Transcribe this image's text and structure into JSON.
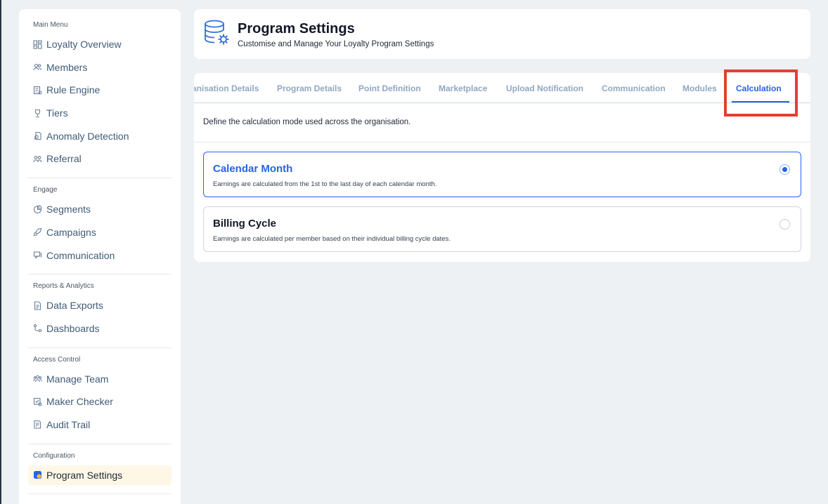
{
  "sidebar": {
    "sections": [
      {
        "title": "Main Menu",
        "items": [
          {
            "label": "Loyalty Overview",
            "icon": "grid-icon"
          },
          {
            "label": "Members",
            "icon": "users-icon"
          },
          {
            "label": "Rule Engine",
            "icon": "rule-icon"
          },
          {
            "label": "Tiers",
            "icon": "trophy-icon"
          },
          {
            "label": "Anomaly Detection",
            "icon": "anomaly-icon"
          },
          {
            "label": "Referral",
            "icon": "referral-icon"
          }
        ]
      },
      {
        "title": "Engage",
        "items": [
          {
            "label": "Segments",
            "icon": "pie-icon"
          },
          {
            "label": "Campaigns",
            "icon": "rocket-icon"
          },
          {
            "label": "Communication",
            "icon": "chat-icon"
          }
        ]
      },
      {
        "title": "Reports & Analytics",
        "items": [
          {
            "label": "Data Exports",
            "icon": "document-icon"
          },
          {
            "label": "Dashboards",
            "icon": "flow-icon"
          }
        ]
      },
      {
        "title": "Access Control",
        "items": [
          {
            "label": "Manage Team",
            "icon": "team-icon"
          },
          {
            "label": "Maker Checker",
            "icon": "checker-icon"
          },
          {
            "label": "Audit Trail",
            "icon": "audit-icon"
          }
        ]
      },
      {
        "title": "Configuration",
        "items": [
          {
            "label": "Program Settings",
            "icon": "settings-icon",
            "active": true
          }
        ]
      }
    ]
  },
  "header": {
    "title": "Program Settings",
    "subtitle": "Customise and Manage Your Loyalty Program Settings",
    "icon": "database-gear-icon"
  },
  "tabs": [
    {
      "label": "anisation Details"
    },
    {
      "label": "Program Details"
    },
    {
      "label": "Point Definition"
    },
    {
      "label": "Marketplace"
    },
    {
      "label": "Upload Notification"
    },
    {
      "label": "Communication"
    },
    {
      "label": "Modules"
    },
    {
      "label": "Calculation",
      "active": true
    }
  ],
  "calculation": {
    "description": "Define the calculation mode used across the organisation.",
    "options": [
      {
        "title": "Calendar Month",
        "description": "Earnings are calculated from the 1st to the last day of each calendar month.",
        "selected": true
      },
      {
        "title": "Billing Cycle",
        "description": "Earnings are calculated per member based on their individual billing cycle dates.",
        "selected": false
      }
    ]
  },
  "colors": {
    "accent": "#2563eb",
    "highlight": "#e0412f",
    "active_nav_bg": "#fff7e6"
  }
}
